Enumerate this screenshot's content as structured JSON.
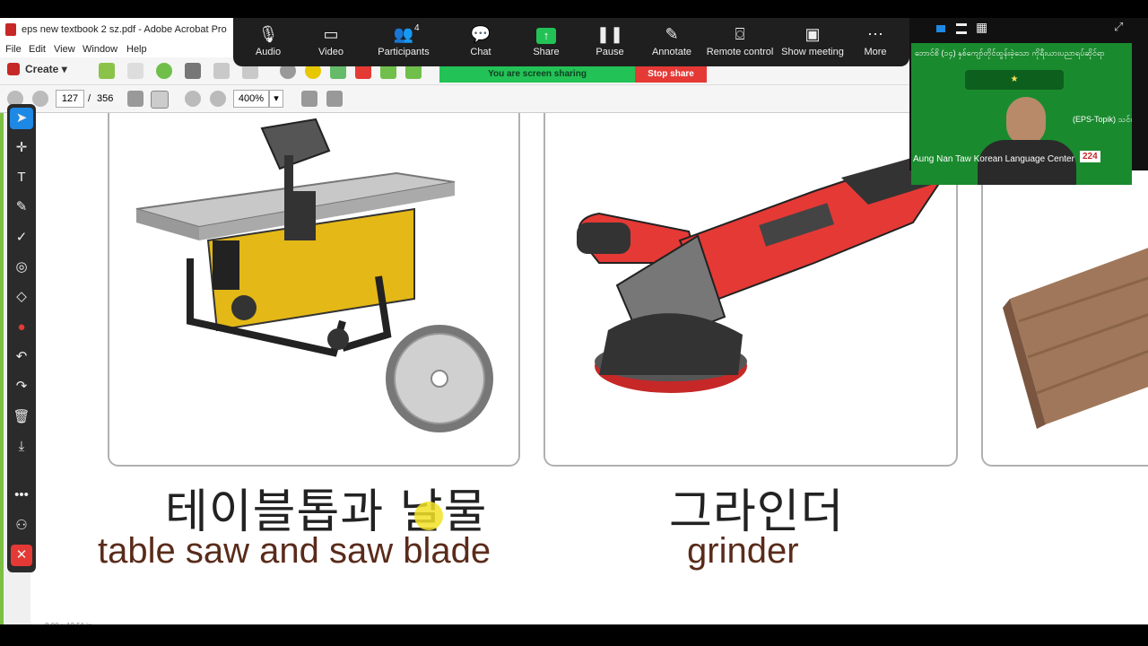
{
  "window": {
    "title": "eps new textbook 2 sz.pdf - Adobe Acrobat Pro"
  },
  "menu": [
    "File",
    "Edit",
    "View",
    "Window",
    "Help"
  ],
  "toolbar": {
    "create_label": "Create"
  },
  "navigation": {
    "current_page": "127",
    "separator": "/",
    "total_pages": "356",
    "zoom": "400%"
  },
  "zoom_controls": [
    {
      "label": "Audio",
      "icon": "mic-icon"
    },
    {
      "label": "Video",
      "icon": "camera-icon"
    },
    {
      "label": "Participants",
      "icon": "people-icon",
      "badge": "4"
    },
    {
      "label": "Chat",
      "icon": "chat-icon"
    },
    {
      "label": "Share",
      "icon": "share-icon"
    },
    {
      "label": "Pause",
      "icon": "pause-icon"
    },
    {
      "label": "Annotate",
      "icon": "pen-icon"
    },
    {
      "label": "Remote control",
      "icon": "mouse-icon"
    },
    {
      "label": "Show meeting",
      "icon": "meeting-icon"
    },
    {
      "label": "More",
      "icon": "more-icon"
    }
  ],
  "share_status": {
    "sharing_text": "You are screen sharing",
    "stop_label": "Stop share"
  },
  "video": {
    "caption": "Aung Nan Taw Korean Language Center",
    "banner_line1": "ဘောင်စိ (၁၄) နှစ်ကျော်တိုင်ထွန်းခဲ့သော ကိုရီးယားပညာရပ်ဆိုင်ရာ",
    "banner_line2": "(EPS-Topik) သင်တန်းကျောင်း",
    "badge": "224"
  },
  "cards": [
    {
      "korean": "테이블톱과 날물",
      "english": "table saw and saw blade"
    },
    {
      "korean": "그라인더",
      "english": "grinder"
    }
  ],
  "status_bar": {
    "size_text": "8.00 x 12.51 in"
  }
}
